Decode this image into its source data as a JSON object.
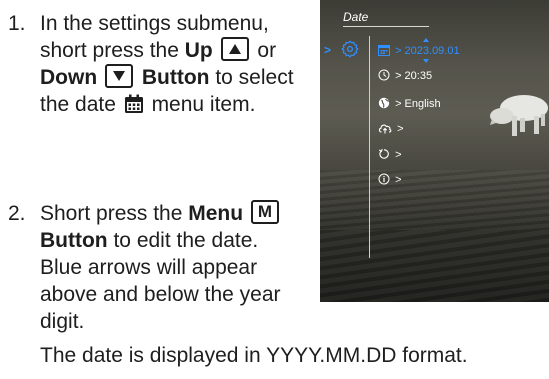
{
  "steps": [
    {
      "number": "1.",
      "t1": "In the settings submenu, short press the ",
      "up_label": "Up",
      "or": " or ",
      "down_label": "Down",
      "button_label": "Button",
      "t2": " to select the date ",
      "t3": " menu item."
    },
    {
      "number": "2.",
      "t1": "Short press the ",
      "menu_label": "Menu",
      "menu_key": "M",
      "button_label": "Button",
      "t2": " to edit the date. Blue arrows will appear above and below the year digit."
    }
  ],
  "footer": "The date is displayed in YYYY.MM.DD format.",
  "device_screen": {
    "title": "Date",
    "items": [
      {
        "icon": "calendar-icon",
        "text": "> 2023.09.01"
      },
      {
        "icon": "clock-icon",
        "text": "> 20:35"
      },
      {
        "icon": "globe-icon",
        "text": "> English"
      },
      {
        "icon": "cloud-upload-icon",
        "text": ">"
      },
      {
        "icon": "reset-icon",
        "text": ">"
      },
      {
        "icon": "info-icon",
        "text": ">"
      }
    ],
    "accent_color": "#2f8fff"
  }
}
